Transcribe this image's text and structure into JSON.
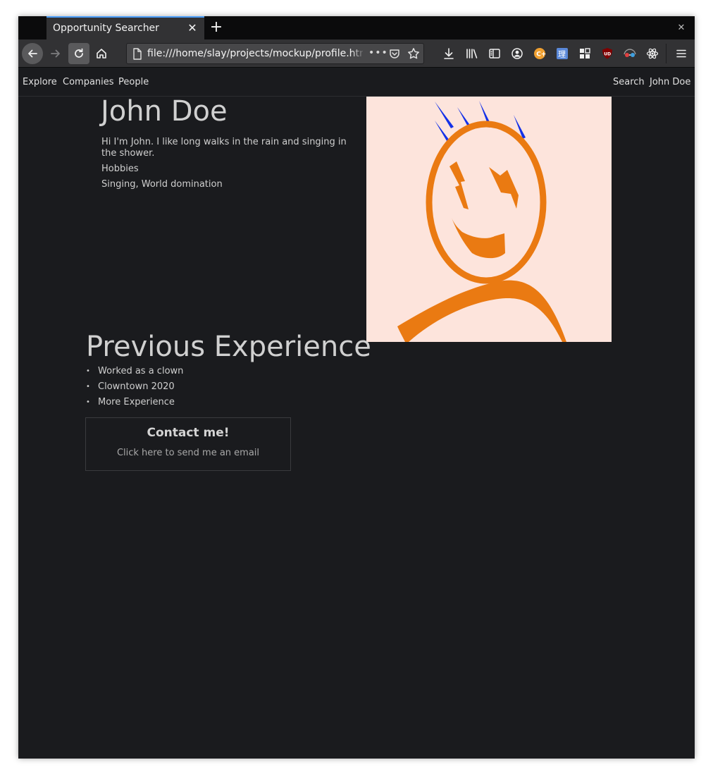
{
  "browser": {
    "tab_title": "Opportunity Searcher",
    "url": "file:///home/slay/projects/mockup/profile.html",
    "icons": [
      "back-icon",
      "forward-icon",
      "reload-icon",
      "home-icon",
      "page-icon",
      "more-dots-icon",
      "pocket-icon",
      "bookmark-star-icon",
      "download-icon",
      "library-icon",
      "sidebar-icon",
      "account-icon",
      "extension-c-icon",
      "extension-kanji-icon",
      "extension-grid-icon",
      "ublock-icon",
      "extension-glasses-icon",
      "react-devtools-icon",
      "menu-icon"
    ]
  },
  "site_nav": {
    "left": [
      "Explore",
      "Companies",
      "People"
    ],
    "search": "Search",
    "user": "John Doe"
  },
  "profile": {
    "name": "John Doe",
    "bio": "Hi I'm John. I like long walks in the rain and singing in the shower.",
    "hobbies_label": "Hobbies",
    "hobbies": "Singing, World domination"
  },
  "experience": {
    "title": "Previous Experience",
    "items": [
      "Worked as a clown",
      "Clowntown 2020",
      "More Experience"
    ]
  },
  "contact": {
    "title": "Contact me!",
    "subtitle": "Click here to send me an email"
  },
  "colors": {
    "page_bg": "#1a1b1e",
    "avatar_bg": "#fde4dc",
    "avatar_orange": "#ea7a12",
    "avatar_blue": "#1431e8",
    "tab_accent": "#4a9df8"
  }
}
